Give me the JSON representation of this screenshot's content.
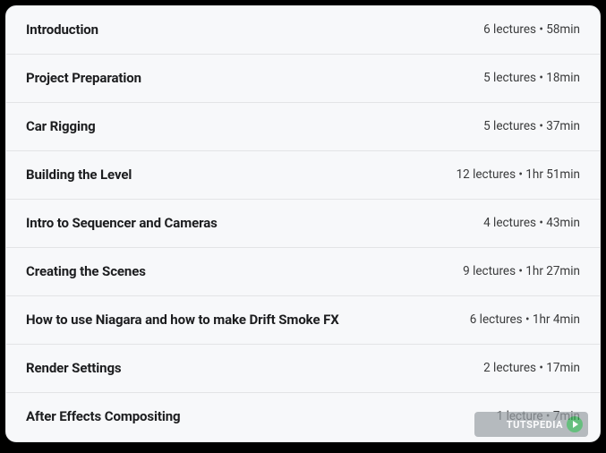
{
  "sections": [
    {
      "title": "Introduction",
      "meta": "6 lectures • 58min"
    },
    {
      "title": "Project Preparation",
      "meta": "5 lectures • 18min"
    },
    {
      "title": "Car Rigging",
      "meta": "5 lectures • 37min"
    },
    {
      "title": "Building the Level",
      "meta": "12 lectures • 1hr 51min"
    },
    {
      "title": "Intro to Sequencer and Cameras",
      "meta": "4 lectures • 43min"
    },
    {
      "title": "Creating the Scenes",
      "meta": "9 lectures • 1hr 27min"
    },
    {
      "title": "How to use Niagara and how to make Drift Smoke FX",
      "meta": "6 lectures • 1hr 4min"
    },
    {
      "title": "Render Settings",
      "meta": "2 lectures • 17min"
    },
    {
      "title": "After Effects Compositing",
      "meta": "1 lecture • 7min"
    }
  ],
  "watermark": {
    "text": "TUTSPEDIA"
  }
}
